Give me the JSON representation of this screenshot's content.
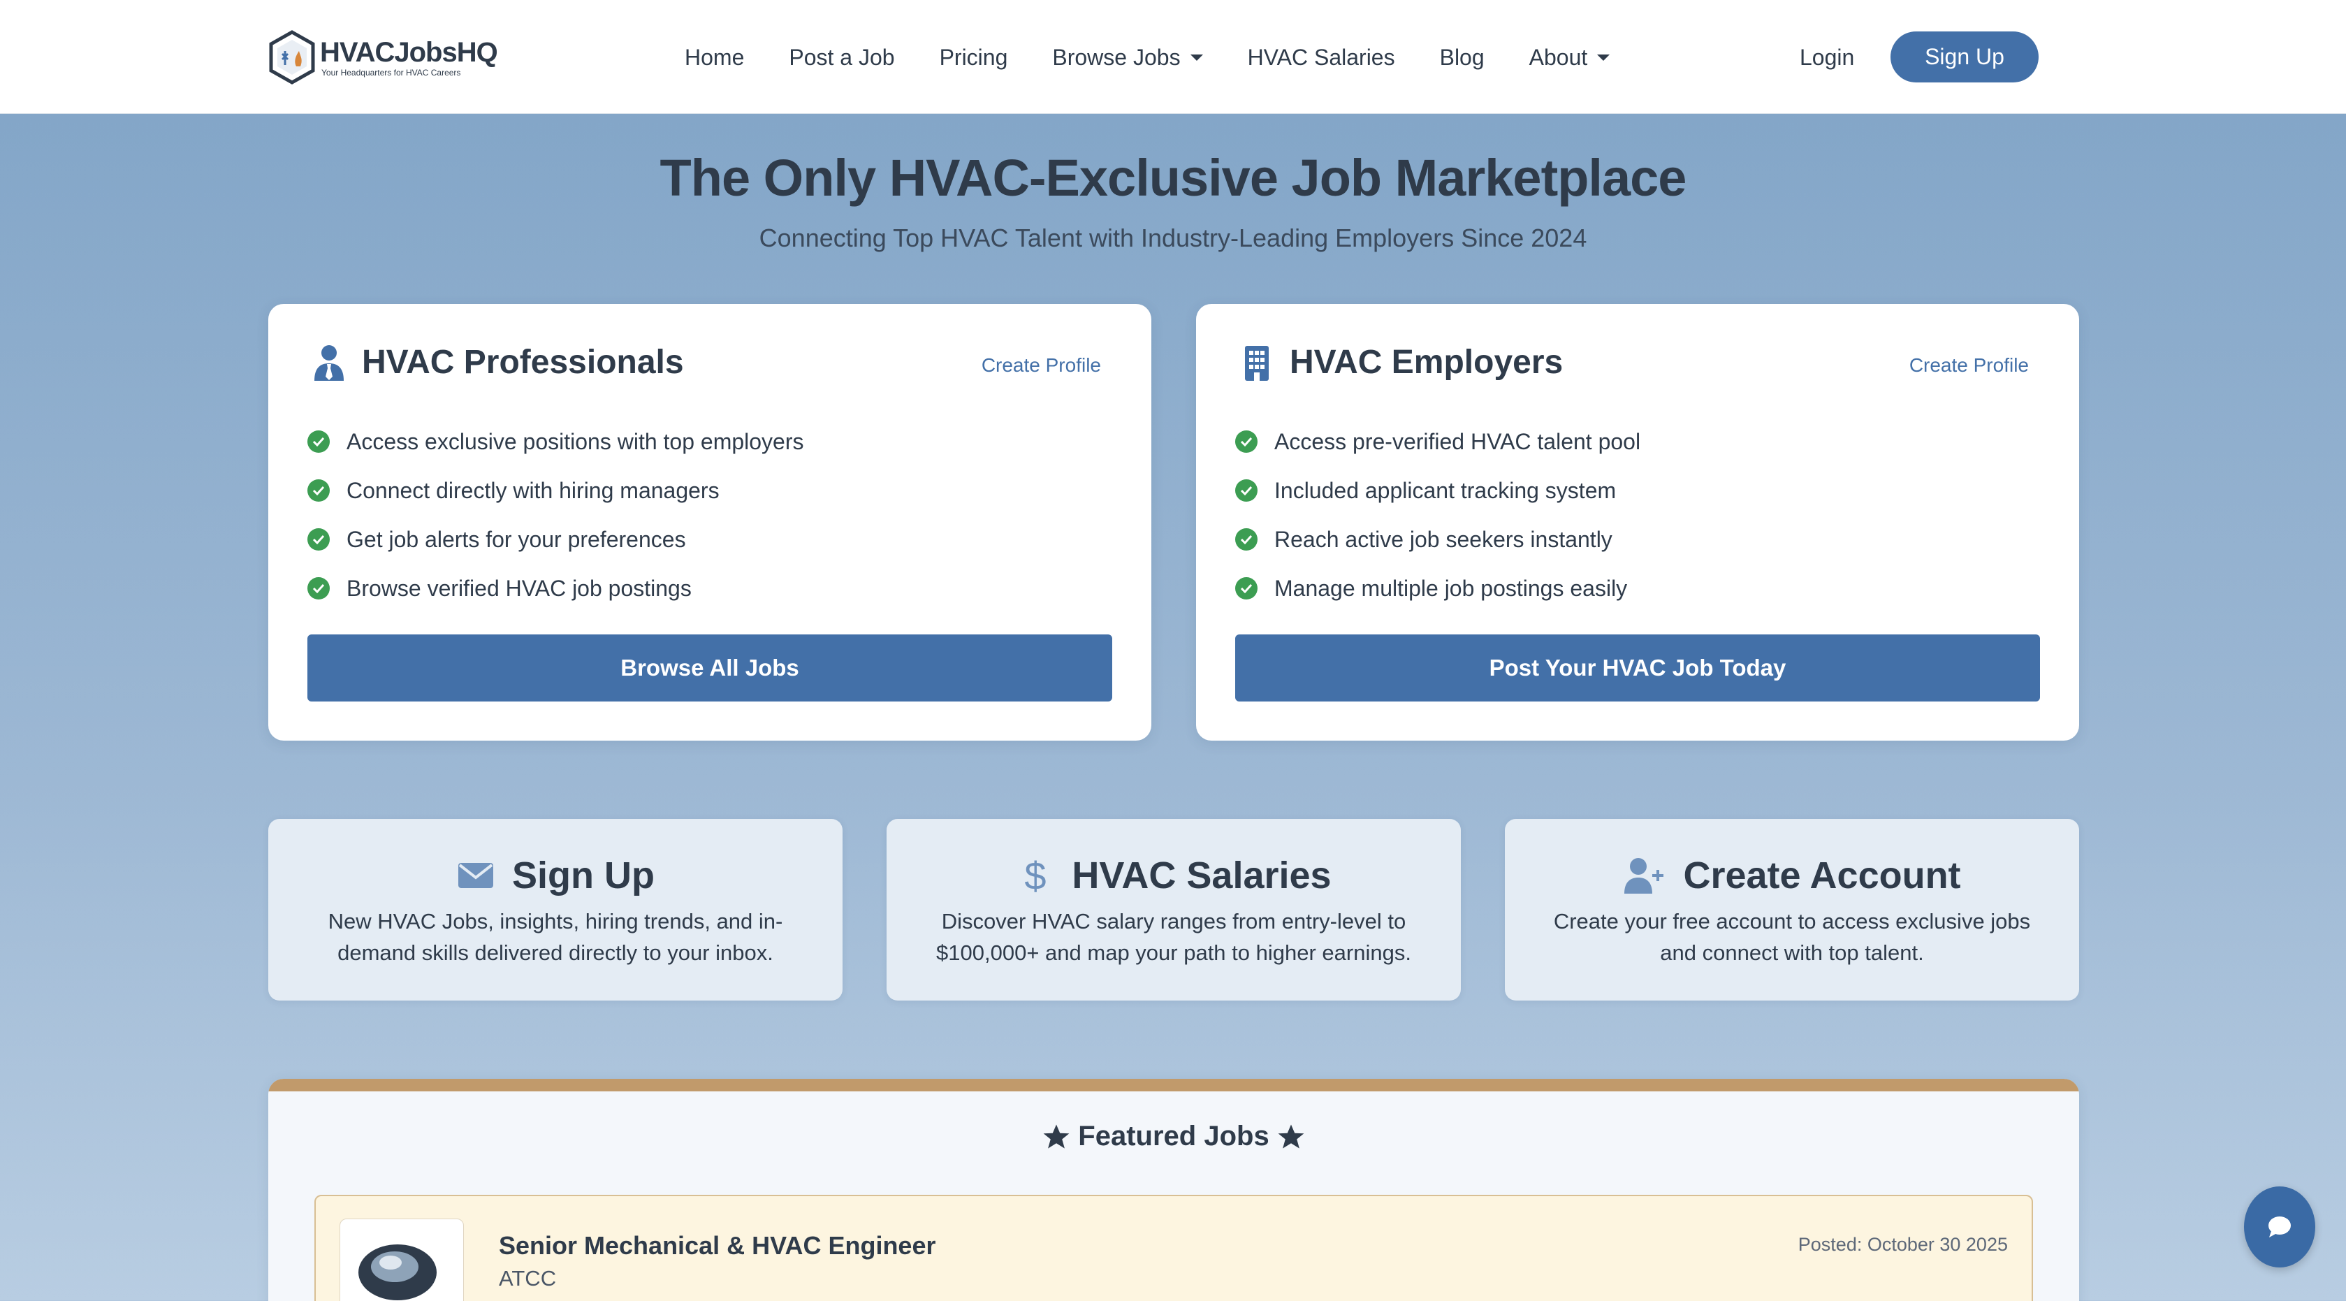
{
  "nav": {
    "brand_name": "HVACJobsHQ",
    "brand_tagline": "Your Headquarters for HVAC Careers",
    "links": [
      {
        "label": "Home"
      },
      {
        "label": "Post a Job"
      },
      {
        "label": "Pricing"
      },
      {
        "label": "Browse Jobs"
      },
      {
        "label": "HVAC Salaries"
      },
      {
        "label": "Blog"
      },
      {
        "label": "About"
      }
    ],
    "login_label": "Login",
    "signup_label": "Sign Up"
  },
  "hero": {
    "title": "The Only HVAC-Exclusive Job Marketplace",
    "subtitle": "Connecting Top HVAC Talent with Industry-Leading Employers Since 2024"
  },
  "professionals": {
    "title": "HVAC Professionals",
    "link": "Create Profile",
    "icon": "user-tie-icon",
    "features": [
      "Access exclusive positions with top employers",
      "Connect directly with hiring managers",
      "Get job alerts for your preferences",
      "Browse verified HVAC job postings"
    ],
    "button": "Browse All Jobs"
  },
  "employers": {
    "title": "HVAC Employers",
    "link": "Create Profile",
    "icon": "building-icon",
    "features": [
      "Access pre-verified HVAC talent pool",
      "Included applicant tracking system",
      "Reach active job seekers instantly",
      "Manage multiple job postings easily"
    ],
    "button": "Post Your HVAC Job Today"
  },
  "info_cards": [
    {
      "title": "Sign Up",
      "icon": "envelope-icon",
      "desc": "New HVAC Jobs, insights, hiring trends, and in-demand skills delivered directly to your inbox."
    },
    {
      "title": "HVAC Salaries",
      "icon": "dollar-icon",
      "desc": "Discover HVAC salary ranges from entry-level to $100,000+ and map your path to higher earnings."
    },
    {
      "title": "Create Account",
      "icon": "user-plus-icon",
      "desc": "Create your free account to access exclusive jobs and connect with top talent."
    }
  ],
  "featured": {
    "title": "Featured Jobs",
    "jobs": [
      {
        "title": "Senior Mechanical & HVAC Engineer",
        "company": "ATCC",
        "posted": "Posted: October 30 2025"
      }
    ]
  },
  "colors": {
    "primary": "#4370a8",
    "text": "#2f3b4a",
    "check": "#3c9d52",
    "featured_accent": "#c19a6b"
  }
}
